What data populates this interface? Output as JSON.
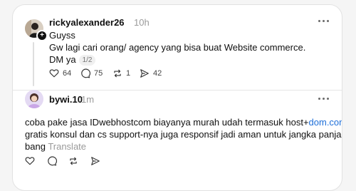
{
  "post": {
    "username": "rickyalexander26",
    "time": "10h",
    "lines": [
      "Guyss",
      "Gw lagi cari orang/ agency yang bisa buat Website commerce.",
      "DM ya"
    ],
    "pager": "1/2",
    "actions": {
      "likes": "64",
      "replies": "75",
      "reposts": "1",
      "shares": "42"
    }
  },
  "reply": {
    "username": "bywi.10",
    "time": "1m",
    "line1_text": "coba pake jasa IDwebhostcom biayanya murah udah termasuk host+",
    "line1_link": "dom.com",
    "line1_tail": ",",
    "line2": "gratis konsul dan cs support-nya juga responsif jadi aman untuk jangka panjang",
    "line3": "bang",
    "translate_label": "Translate"
  },
  "colors": {
    "link": "#1e6fd9",
    "muted": "#9a9a9a",
    "text": "#101010"
  }
}
